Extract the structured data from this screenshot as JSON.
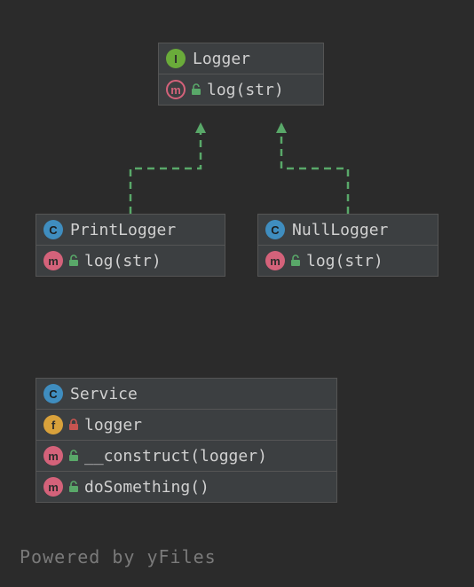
{
  "colors": {
    "background": "#2b2b2b",
    "panel": "#3c3f41",
    "border": "#555555",
    "arrow": "#59a869",
    "interface": "#6aab3a",
    "class": "#3f8dbf",
    "method": "#d4627a",
    "field": "#d8a13b",
    "public": "#59a869",
    "private": "#c75450"
  },
  "footer": "Powered by yFiles",
  "boxes": {
    "logger": {
      "type": "interface",
      "typeLetter": "I",
      "name": "Logger",
      "members": [
        {
          "kind": "method",
          "kindLetter": "m",
          "abstract": true,
          "visibility": "public",
          "signature": "log(str)"
        }
      ]
    },
    "printLogger": {
      "type": "class",
      "typeLetter": "C",
      "name": "PrintLogger",
      "members": [
        {
          "kind": "method",
          "kindLetter": "m",
          "abstract": false,
          "visibility": "public",
          "signature": "log(str)"
        }
      ]
    },
    "nullLogger": {
      "type": "class",
      "typeLetter": "C",
      "name": "NullLogger",
      "members": [
        {
          "kind": "method",
          "kindLetter": "m",
          "abstract": false,
          "visibility": "public",
          "signature": "log(str)"
        }
      ]
    },
    "service": {
      "type": "class",
      "typeLetter": "C",
      "name": "Service",
      "members": [
        {
          "kind": "field",
          "kindLetter": "f",
          "abstract": false,
          "visibility": "private",
          "signature": "logger"
        },
        {
          "kind": "method",
          "kindLetter": "m",
          "abstract": false,
          "visibility": "public",
          "signature": "__construct(logger)"
        },
        {
          "kind": "method",
          "kindLetter": "m",
          "abstract": false,
          "visibility": "public",
          "signature": "doSomething()"
        }
      ]
    }
  },
  "relations": [
    {
      "from": "printLogger",
      "to": "logger",
      "style": "implements"
    },
    {
      "from": "nullLogger",
      "to": "logger",
      "style": "implements"
    }
  ]
}
